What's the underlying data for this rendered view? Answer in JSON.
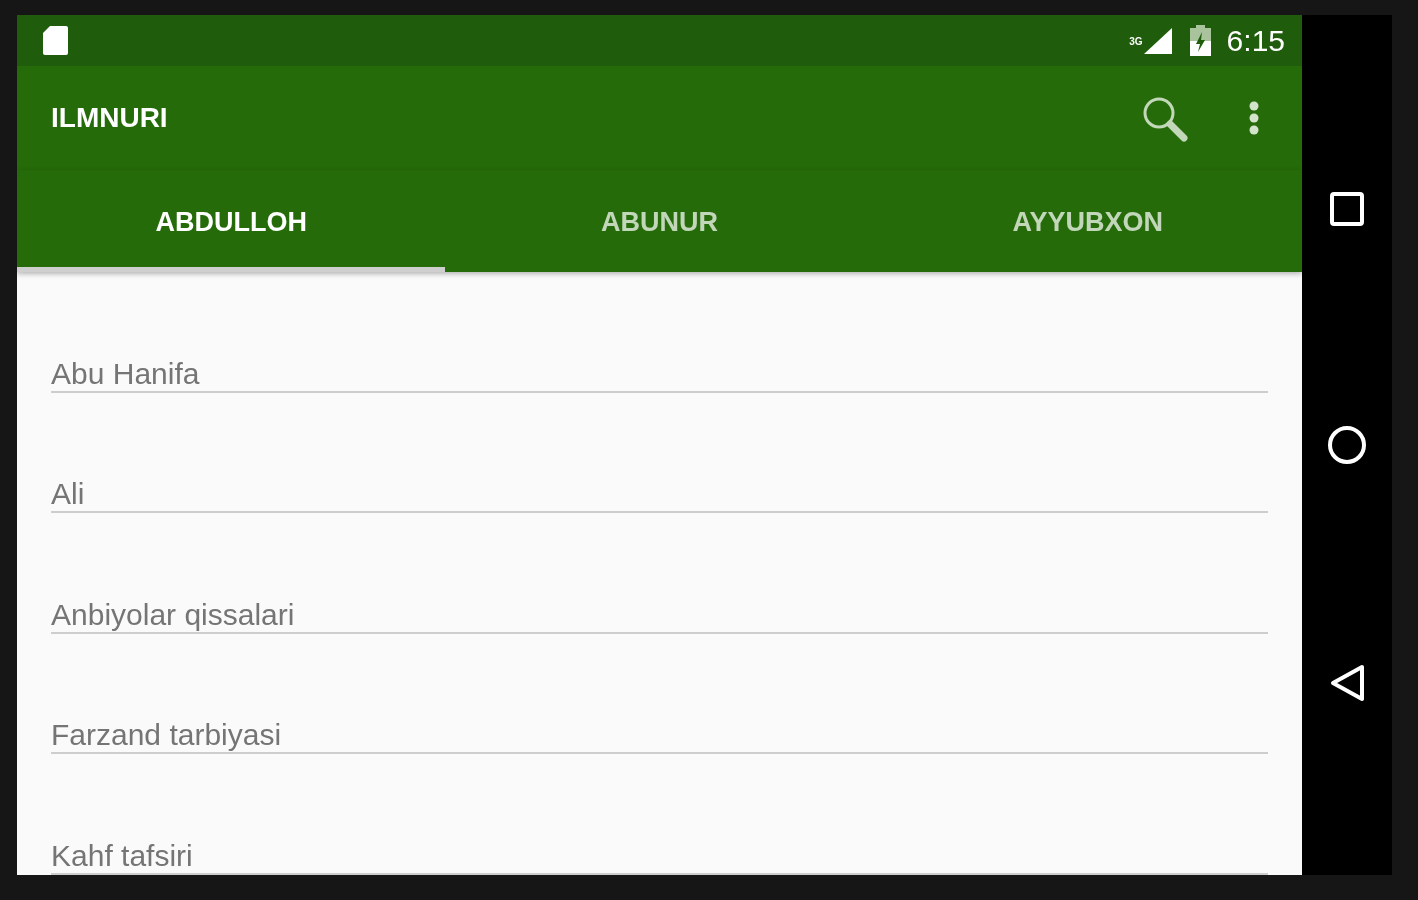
{
  "status_bar": {
    "network": "3G",
    "time": "6:15"
  },
  "app_bar": {
    "title": "ILMNURI"
  },
  "tabs": [
    {
      "label": "ABDULLOH",
      "selected": true
    },
    {
      "label": "ABUNUR",
      "selected": false
    },
    {
      "label": "AYYUBXON",
      "selected": false
    }
  ],
  "list": {
    "items": [
      {
        "label": "Abu Hanifa"
      },
      {
        "label": "Ali"
      },
      {
        "label": "Anbiyolar qissalari"
      },
      {
        "label": "Farzand tarbiyasi"
      },
      {
        "label": "Kahf tafsiri"
      }
    ]
  }
}
